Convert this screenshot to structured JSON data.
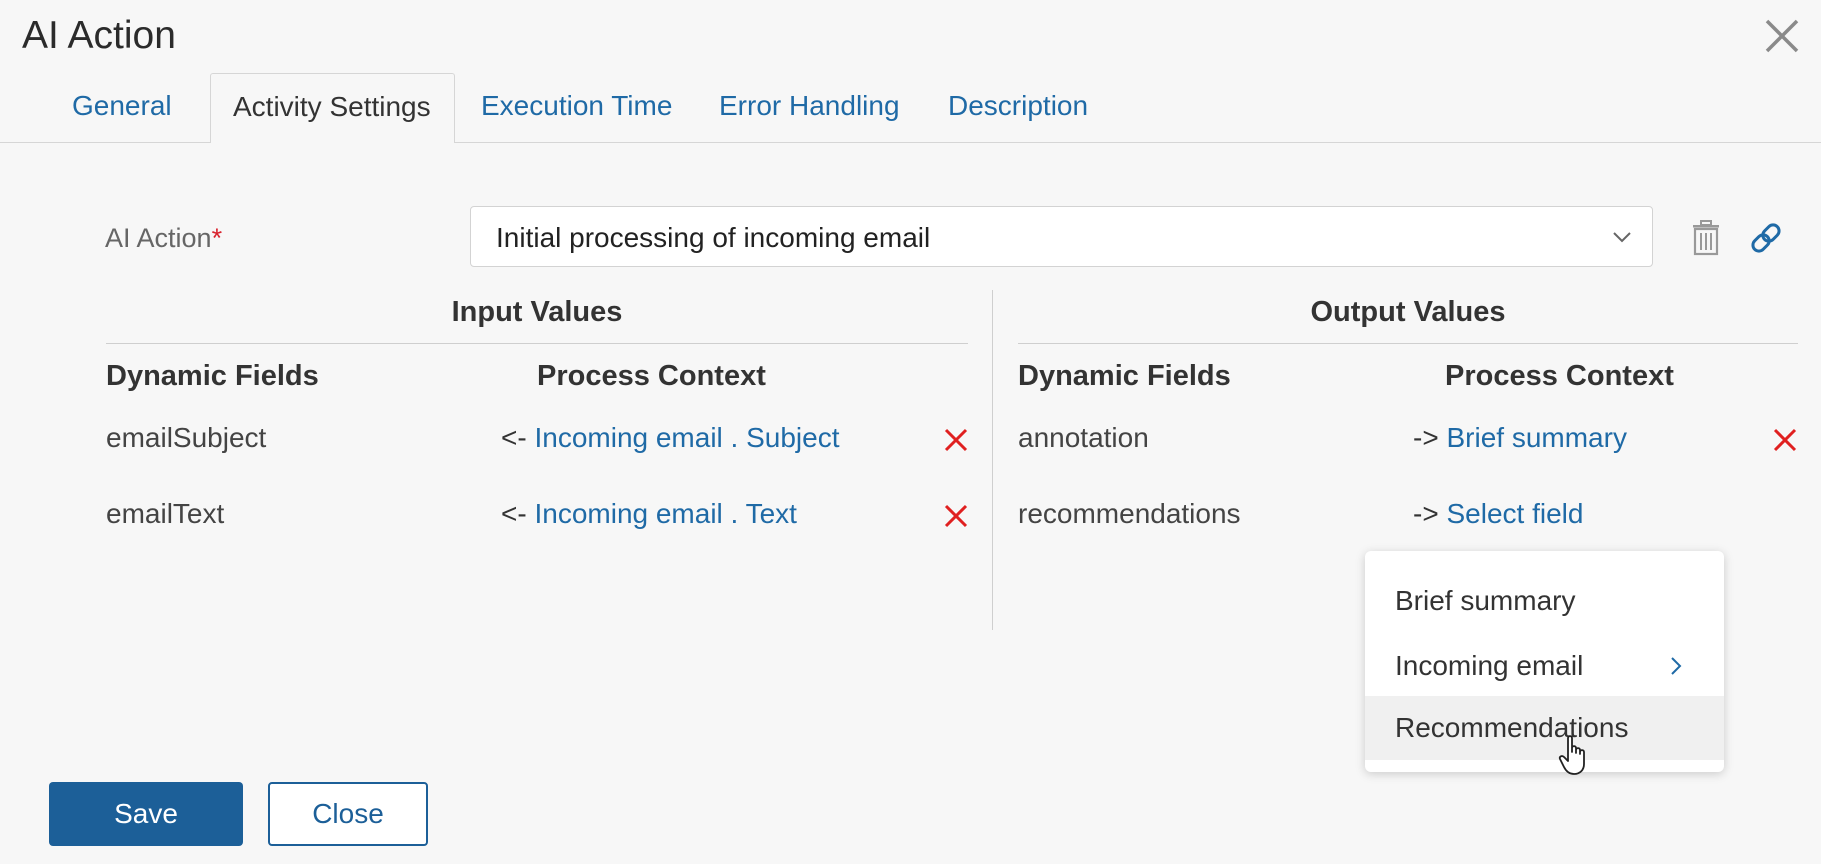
{
  "dialog": {
    "title": "AI Action"
  },
  "tabs": [
    {
      "label": "General"
    },
    {
      "label": "Activity Settings"
    },
    {
      "label": "Execution Time"
    },
    {
      "label": "Error Handling"
    },
    {
      "label": "Description"
    }
  ],
  "ai_action": {
    "label": "AI Action",
    "required_mark": "*",
    "selected_value": "Initial processing of incoming email"
  },
  "input_values": {
    "heading": "Input Values",
    "col_fields": "Dynamic Fields",
    "col_context": "Process Context",
    "rows": [
      {
        "field": "emailSubject",
        "arrow": "<-",
        "context": "Incoming email . Subject"
      },
      {
        "field": "emailText",
        "arrow": "<-",
        "context": "Incoming email . Text"
      }
    ]
  },
  "output_values": {
    "heading": "Output Values",
    "col_fields": "Dynamic Fields",
    "col_context": "Process Context",
    "rows": [
      {
        "field": "annotation",
        "arrow": "->",
        "context": "Brief summary"
      },
      {
        "field": "recommendations",
        "arrow": "->",
        "context": "Select field"
      }
    ]
  },
  "dropdown": {
    "items": [
      {
        "label": "Brief summary",
        "has_submenu": false
      },
      {
        "label": "Incoming email",
        "has_submenu": true
      },
      {
        "label": "Recommendations",
        "has_submenu": false,
        "hovered": true
      }
    ]
  },
  "buttons": {
    "save": "Save",
    "close": "Close"
  },
  "colors": {
    "link": "#1f6aa6",
    "primary_button": "#1c5f98",
    "delete_x": "#e02020",
    "required": "#d9232e"
  }
}
